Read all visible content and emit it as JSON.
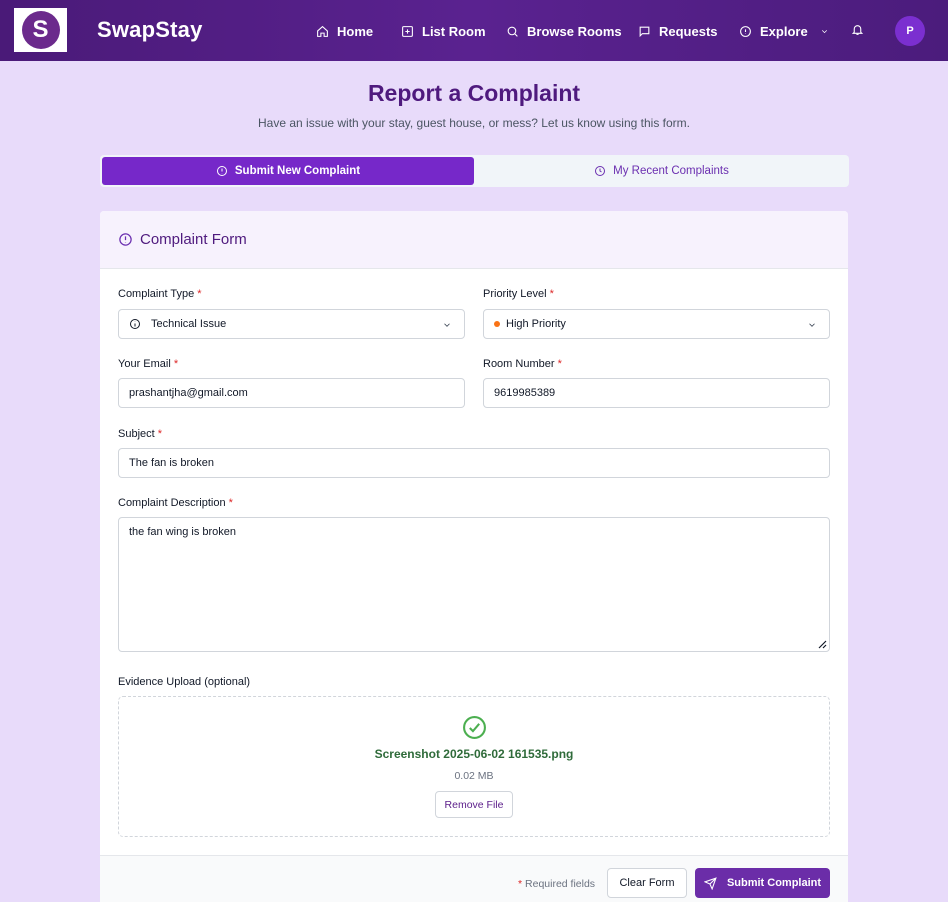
{
  "nav": {
    "logo_letter": "S",
    "brand": "SwapStay",
    "items": [
      {
        "label": "Home",
        "icon": "home-icon"
      },
      {
        "label": "List Room",
        "icon": "plus-square-icon"
      },
      {
        "label": "Browse Rooms",
        "icon": "search-icon"
      },
      {
        "label": "Requests",
        "icon": "message-icon"
      },
      {
        "label": "Explore",
        "icon": "info-icon"
      }
    ],
    "avatar_letter": "P"
  },
  "header": {
    "title": "Report a Complaint",
    "subtitle": "Have an issue with your stay, guest house, or mess? Let us know using this form."
  },
  "tabs": {
    "active": "Submit New Complaint",
    "inactive": "My Recent Complaints"
  },
  "form": {
    "title": "Complaint Form",
    "complaint_type": {
      "label": "Complaint Type",
      "value": "Technical Issue"
    },
    "priority": {
      "label": "Priority Level",
      "value": "High Priority",
      "dot_color": "#f97316"
    },
    "email": {
      "label": "Your Email",
      "value": "prashantjha@gmail.com"
    },
    "room": {
      "label": "Room Number",
      "value": "9619985389"
    },
    "subject": {
      "label": "Subject",
      "value": "The fan is broken"
    },
    "description": {
      "label": "Complaint Description",
      "value": "the fan wing is broken"
    },
    "upload": {
      "label": "Evidence Upload (optional)",
      "filename": "Screenshot 2025-06-02 161535.png",
      "size": "0.02 MB",
      "remove_label": "Remove File"
    },
    "required_marker": "*",
    "required_note": "Required fields",
    "clear_label": "Clear Form",
    "submit_label": "Submit Complaint"
  },
  "colors": {
    "accent": "#7628c9",
    "nav_bg": "#4a1a78",
    "page_bg": "#e8dbfa",
    "success": "#4caf50"
  }
}
